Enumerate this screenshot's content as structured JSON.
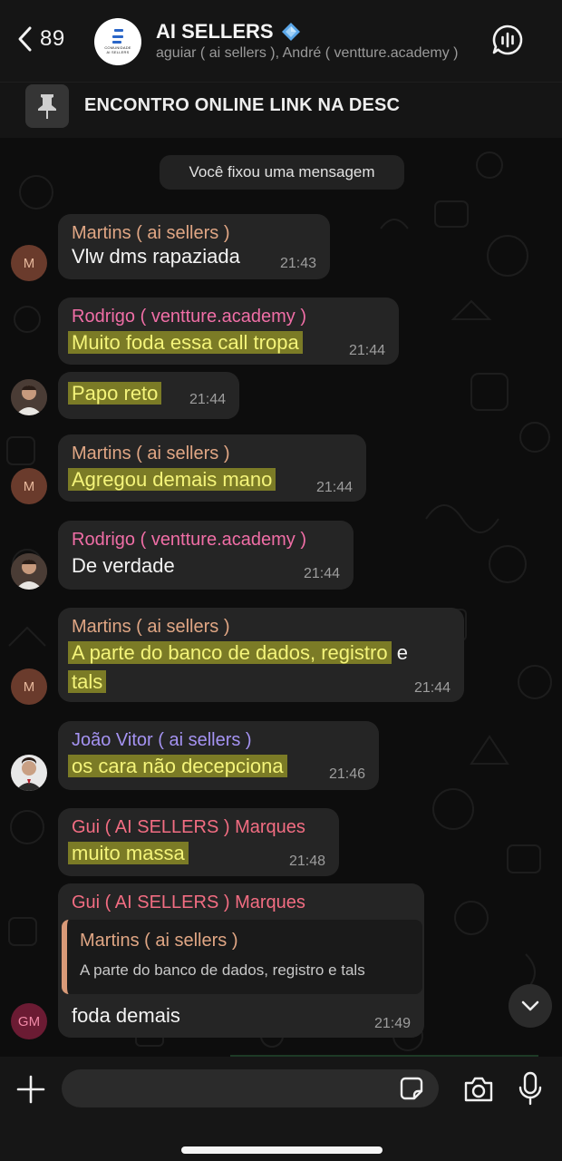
{
  "header": {
    "back_count": "89",
    "title": "AI SELLERS",
    "title_emoji_icon": "blue-diamond-emoji",
    "subtitle": "aguiar ( ai sellers ), André ( ventture.academy )",
    "avatar_logo_line1": "COMUNIDADE",
    "avatar_logo_line2": "AI SELLERS"
  },
  "pinned": {
    "text": "ENCONTRO ONLINE LINK NA DESC"
  },
  "system_message": "Você fixou uma mensagem",
  "messages": [
    {
      "sender": "Martins ( ai sellers )",
      "text": "Vlw dms rapaziada",
      "time": "21:43",
      "avatar": "M"
    },
    {
      "sender": "Rodrigo ( ventture.academy )",
      "text": "Muito foda essa call tropa",
      "time": "21:44"
    },
    {
      "text": "Papo reto",
      "time": "21:44"
    },
    {
      "sender": "Martins ( ai sellers )",
      "text": "Agregou demais mano",
      "time": "21:44",
      "avatar": "M"
    },
    {
      "sender": "Rodrigo ( ventture.academy )",
      "text": "De verdade",
      "time": "21:44"
    },
    {
      "sender": "Martins ( ai sellers )",
      "text_line1": "A parte do banco de dados, registro",
      "text_line1_tail": " e",
      "text_line2": "tals",
      "time": "21:44",
      "avatar": "M"
    },
    {
      "sender": "João Vitor ( ai sellers )",
      "text": "os cara não decepciona",
      "time": "21:46"
    },
    {
      "sender": "Gui ( AI SELLERS ) Marques",
      "text": "muito massa",
      "time": "21:48"
    },
    {
      "sender": "Gui ( AI SELLERS ) Marques",
      "quote_sender": "Martins ( ai sellers )",
      "quote_text": "A parte do banco de dados, registro e tals",
      "text": "foda demais",
      "time": "21:49",
      "avatar": "GM"
    }
  ],
  "composer": {
    "placeholder": ""
  },
  "colors": {
    "martins": "#e0a684",
    "rodrigo": "#f06ea6",
    "joao": "#a593f2",
    "gui": "#f26d82",
    "highlight": "#e4e428"
  }
}
